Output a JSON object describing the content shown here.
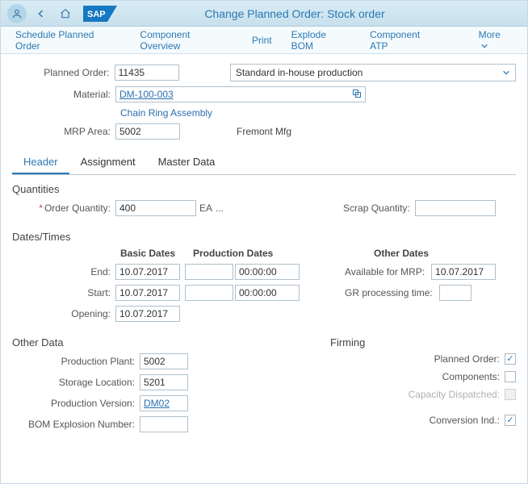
{
  "titlebar": {
    "title": "Change Planned Order: Stock order"
  },
  "actions": {
    "schedule": "Schedule Planned Order",
    "component_overview": "Component Overview",
    "print": "Print",
    "explode_bom": "Explode BOM",
    "component_atp": "Component ATP",
    "more": "More"
  },
  "form": {
    "planned_order_label": "Planned Order:",
    "planned_order_value": "11435",
    "order_type": "Standard in-house production",
    "material_label": "Material:",
    "material_value": "DM-100-003",
    "material_desc": "Chain Ring Assembly",
    "mrp_area_label": "MRP Area:",
    "mrp_area_value": "5002",
    "mrp_area_desc": "Fremont Mfg"
  },
  "tabs": {
    "header": "Header",
    "assignment": "Assignment",
    "master_data": "Master Data"
  },
  "quantities": {
    "section": "Quantities",
    "order_qty_label": "Order Quantity:",
    "order_qty_value": "400",
    "order_qty_unit": "EA",
    "ellipsis": "...",
    "scrap_label": "Scrap Quantity:",
    "scrap_value": ""
  },
  "datestimes": {
    "section": "Dates/Times",
    "col_basic": "Basic Dates",
    "col_prod": "Production Dates",
    "col_other": "Other Dates",
    "end_label": "End:",
    "end_basic": "10.07.2017",
    "end_prod_date": "",
    "end_prod_time": "00:00:00",
    "start_label": "Start:",
    "start_basic": "10.07.2017",
    "start_prod_date": "",
    "start_prod_time": "00:00:00",
    "opening_label": "Opening:",
    "opening_basic": "10.07.2017",
    "avail_label": "Available for MRP:",
    "avail_value": "10.07.2017",
    "gr_label": "GR processing time:",
    "gr_value": ""
  },
  "otherdata": {
    "section": "Other Data",
    "prod_plant_label": "Production Plant:",
    "prod_plant_value": "5002",
    "storage_loc_label": "Storage Location:",
    "storage_loc_value": "5201",
    "prod_version_label": "Production Version:",
    "prod_version_value": "DM02",
    "bom_expl_label": "BOM Explosion Number:",
    "bom_expl_value": ""
  },
  "firming": {
    "section": "Firming",
    "planned_order_label": "Planned Order:",
    "components_label": "Components:",
    "capacity_label": "Capacity Dispatched:",
    "conversion_label": "Conversion Ind.:"
  }
}
